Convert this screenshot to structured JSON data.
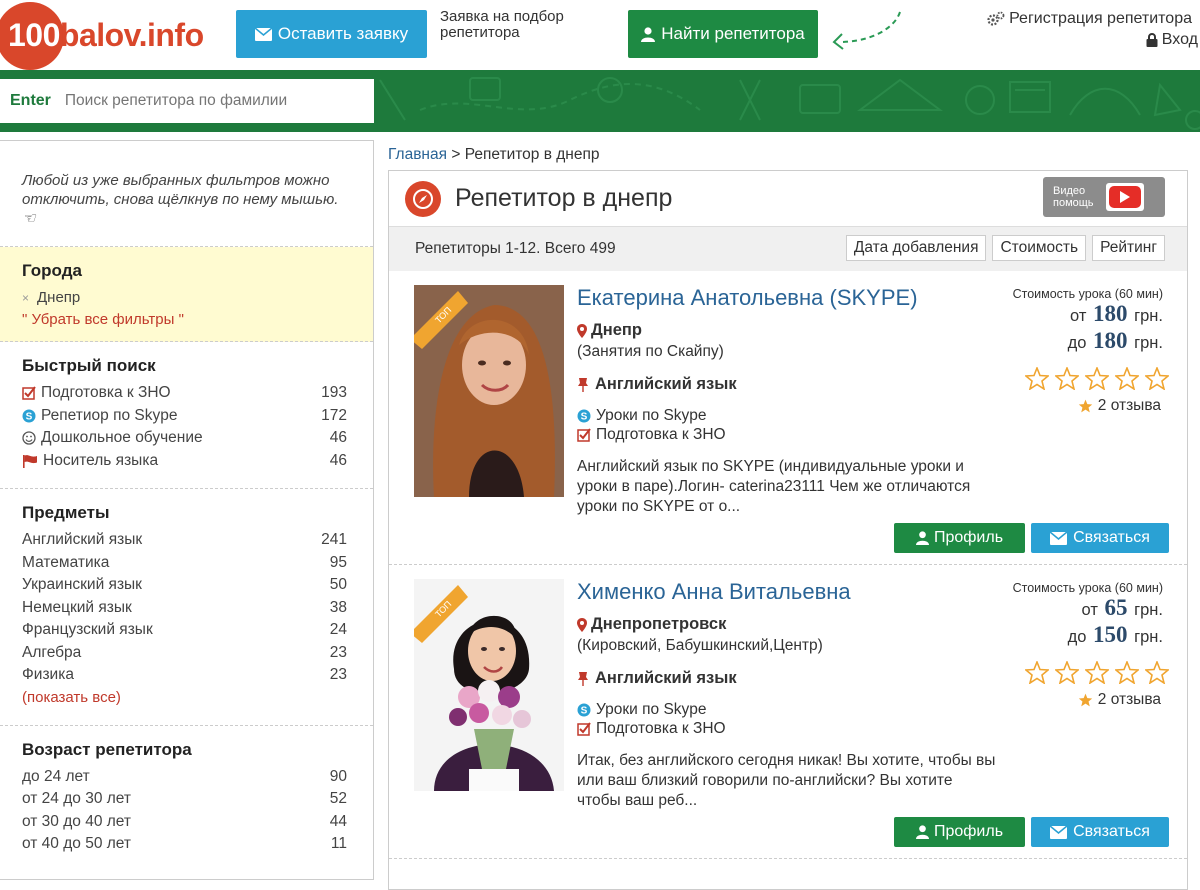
{
  "header": {
    "logo": {
      "prefix": "100",
      "rest": "balov.info"
    },
    "leave_request_label": "Оставить заявку",
    "request_note": "Заявка на подбор репетитора",
    "find_tutor_label": "Найти репетитора",
    "register_label": "Регистрация репетитора",
    "login_label": "Вход"
  },
  "search": {
    "enter_label": "Enter",
    "placeholder": "Поиск репетитора по фамилии"
  },
  "sidebar": {
    "hint": "Любой из уже выбранных фильтров можно отключить, снова щёлкнув по нему мышью.",
    "cities": {
      "title": "Города",
      "selected": "Днепр",
      "remove_all": "\" Убрать все фильтры \""
    },
    "quick": {
      "title": "Быстрый поиск",
      "items": [
        {
          "label": "Подготовка к ЗНО",
          "count": "193",
          "icon": "checkbox-icon"
        },
        {
          "label": "Репетиор по Skype",
          "count": "172",
          "icon": "skype-icon"
        },
        {
          "label": "Дошкольное обучение",
          "count": "46",
          "icon": "smile-icon"
        },
        {
          "label": "Носитель языка",
          "count": "46",
          "icon": "flag-icon"
        }
      ]
    },
    "subjects": {
      "title": "Предметы",
      "items": [
        {
          "label": "Английский язык",
          "count": "241"
        },
        {
          "label": "Математика",
          "count": "95"
        },
        {
          "label": "Украинский язык",
          "count": "50"
        },
        {
          "label": "Немецкий язык",
          "count": "38"
        },
        {
          "label": "Французский язык",
          "count": "24"
        },
        {
          "label": "Алгебра",
          "count": "23"
        },
        {
          "label": "Физика",
          "count": "23"
        }
      ],
      "show_all": "(показать все)"
    },
    "age": {
      "title": "Возраст репетитора",
      "items": [
        {
          "label": "до 24 лет",
          "count": "90"
        },
        {
          "label": "от 24 до 30 лет",
          "count": "52"
        },
        {
          "label": "от 30 до 40 лет",
          "count": "44"
        },
        {
          "label": "от 40 до 50 лет",
          "count": "11"
        }
      ]
    }
  },
  "breadcrumb": {
    "home": "Главная",
    "sep": ">",
    "current": "Репетитор в днепр"
  },
  "main": {
    "title": "Репетитор в днепр",
    "video_help": {
      "line1": "Видео",
      "line2": "помощь"
    },
    "summary": "Репетиторы 1-12. Всего 499",
    "sort_options": [
      "Дата добавления",
      "Стоимость",
      "Рейтинг"
    ],
    "tutors": [
      {
        "badge": "ТОП",
        "name": "Екатерина Анатольевна (SKYPE)",
        "city": "Днепр",
        "area": "(Занятия по Скайпу)",
        "subject": "Английский язык",
        "features": [
          "Уроки по Skype",
          "Подготовка к ЗНО"
        ],
        "description": "Английский язык по SKYPE (индивидуальные уроки и уроки в паре).Логин- caterina23111 Чем же отличаются уроки по SKYPE от о...",
        "price_label": "Стоимость урока (60 мин)",
        "price_from_prefix": "от",
        "price_from": "180",
        "price_to_prefix": "до",
        "price_to": "180",
        "currency": "грн.",
        "rating": 0,
        "reviews": "2 отзыва",
        "profile_label": "Профиль",
        "contact_label": "Связаться"
      },
      {
        "badge": "ТОП",
        "name": "Хименко Анна Витальевна",
        "city": "Днепропетровск",
        "area": "(Кировский, Бабушкинский,Центр)",
        "subject": "Английский язык",
        "features": [
          "Уроки по Skype",
          "Подготовка к ЗНО"
        ],
        "description": "Итак, без английского сегодня никак! Вы хотите, чтобы вы или ваш близкий говорили по-английски? Вы хотите чтобы ваш реб...",
        "price_label": "Стоимость урока (60 мин)",
        "price_from_prefix": "от",
        "price_from": "65",
        "price_to_prefix": "до",
        "price_to": "150",
        "currency": "грн.",
        "rating": 0,
        "reviews": "2 отзыва",
        "profile_label": "Профиль",
        "contact_label": "Связаться"
      }
    ]
  },
  "colors": {
    "brand_red": "#d9472b",
    "green": "#1e8a43",
    "blue": "#2aa1d4",
    "link": "#2a6496"
  }
}
